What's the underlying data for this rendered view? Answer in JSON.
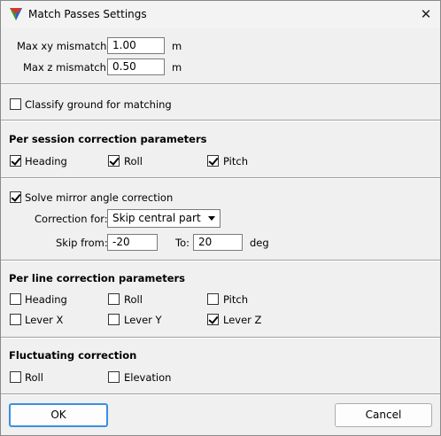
{
  "window": {
    "title": "Match Passes Settings",
    "icon": "triangle-app-icon",
    "close_icon": "close-icon"
  },
  "mismatch": {
    "xy_label": "Max xy mismatch:",
    "xy_value": "1.00",
    "xy_unit": "m",
    "z_label": "Max z mismatch:",
    "z_value": "0.50",
    "z_unit": "m"
  },
  "classify": {
    "label": "Classify ground for matching",
    "checked": false
  },
  "session": {
    "title": "Per session correction parameters",
    "heading": {
      "label": "Heading",
      "checked": true
    },
    "roll": {
      "label": "Roll",
      "checked": true
    },
    "pitch": {
      "label": "Pitch",
      "checked": true
    }
  },
  "mirror": {
    "label": "Solve mirror angle correction",
    "checked": true,
    "correction_for_label": "Correction for:",
    "correction_for_value": "Skip central part",
    "skip_from_label": "Skip from:",
    "skip_from_value": "-20",
    "to_label": "To:",
    "to_value": "20",
    "unit": "deg"
  },
  "line": {
    "title": "Per line correction parameters",
    "heading": {
      "label": "Heading",
      "checked": false
    },
    "roll": {
      "label": "Roll",
      "checked": false
    },
    "pitch": {
      "label": "Pitch",
      "checked": false
    },
    "lever_x": {
      "label": "Lever X",
      "checked": false
    },
    "lever_y": {
      "label": "Lever Y",
      "checked": false
    },
    "lever_z": {
      "label": "Lever Z",
      "checked": true
    }
  },
  "fluct": {
    "title": "Fluctuating correction",
    "roll": {
      "label": "Roll",
      "checked": false
    },
    "elevation": {
      "label": "Elevation",
      "checked": false
    }
  },
  "buttons": {
    "ok": "OK",
    "cancel": "Cancel"
  }
}
